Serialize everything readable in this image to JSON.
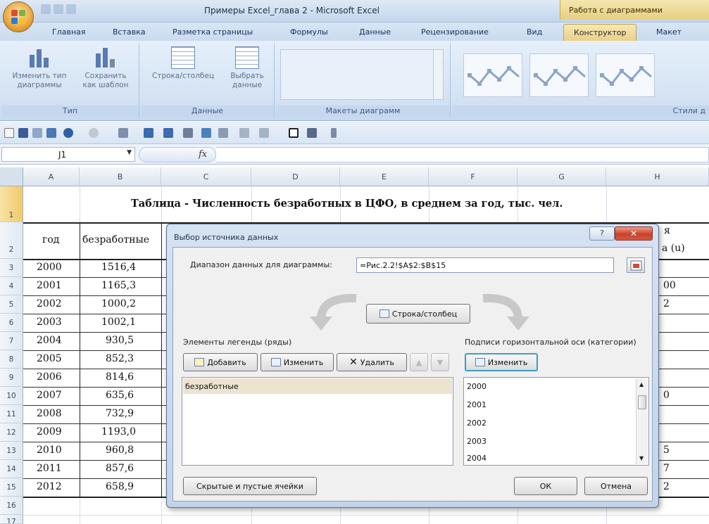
{
  "titlebar": {
    "title": "Примеры Excel_глава 2 - Microsoft Excel",
    "context_group": "Работа с диаграммами"
  },
  "tabs": [
    "Главная",
    "Вставка",
    "Разметка страницы",
    "Формулы",
    "Данные",
    "Рецензирование",
    "Вид",
    "Конструктор",
    "Макет"
  ],
  "ribbon": {
    "change_type": "Изменить тип\nдиаграммы",
    "save_template": "Сохранить\nкак шаблон",
    "group_type": "Тип",
    "row_col": "Строка/столбец",
    "select_data": "Выбрать\nданные",
    "group_data": "Данные",
    "group_layouts": "Макеты диаграмм",
    "group_styles": "Стили д"
  },
  "formula_bar": {
    "cell": "J1",
    "fx": "fx"
  },
  "sheet": {
    "columns": [
      "A",
      "B",
      "C",
      "D",
      "E",
      "F",
      "G",
      "H"
    ],
    "rows": [
      "1",
      "2",
      "3",
      "4",
      "5",
      "6",
      "7",
      "8",
      "9",
      "10",
      "11",
      "12",
      "13",
      "14",
      "15",
      "16",
      "17"
    ],
    "title": "Таблица - Численность безработных в ЦФО, в среднем за год, тыс. чел.",
    "header_a": "год",
    "header_b": "безработные",
    "header_h_partial": "а (u)",
    "header_h_top": "я",
    "years": [
      "2000",
      "2001",
      "2002",
      "2003",
      "2004",
      "2005",
      "2006",
      "2007",
      "2008",
      "2009",
      "2010",
      "2011",
      "2012"
    ],
    "values": [
      "1516,4",
      "1165,3",
      "1000,2",
      "1002,1",
      "930,5",
      "852,3",
      "814,6",
      "635,6",
      "732,9",
      "1193,0",
      "960,8",
      "857,6",
      "658,9"
    ],
    "h_fragments": {
      "r4": "00",
      "r5": "2",
      "r10": "0",
      "r13": "5",
      "r14": "7",
      "r15": "2"
    }
  },
  "dialog": {
    "title": "Выбор источника данных",
    "help": "?",
    "close": "✕",
    "range_label": "Диапазон данных для диаграммы:",
    "range_value": "=Рис.2.2!$A$2:$B$15",
    "switch_button": "Строка/столбец",
    "legend_label": "Элементы легенды (ряды)",
    "add": "Добавить",
    "edit": "Изменить",
    "remove": "Удалить",
    "legend_items": [
      "безработные"
    ],
    "axis_label": "Подписи горизонтальной оси (категории)",
    "axis_edit": "Изменить",
    "axis_items": [
      "2000",
      "2001",
      "2002",
      "2003",
      "2004"
    ],
    "hidden_cells": "Скрытые и пустые ячейки",
    "ok": "ОК",
    "cancel": "Отмена"
  }
}
